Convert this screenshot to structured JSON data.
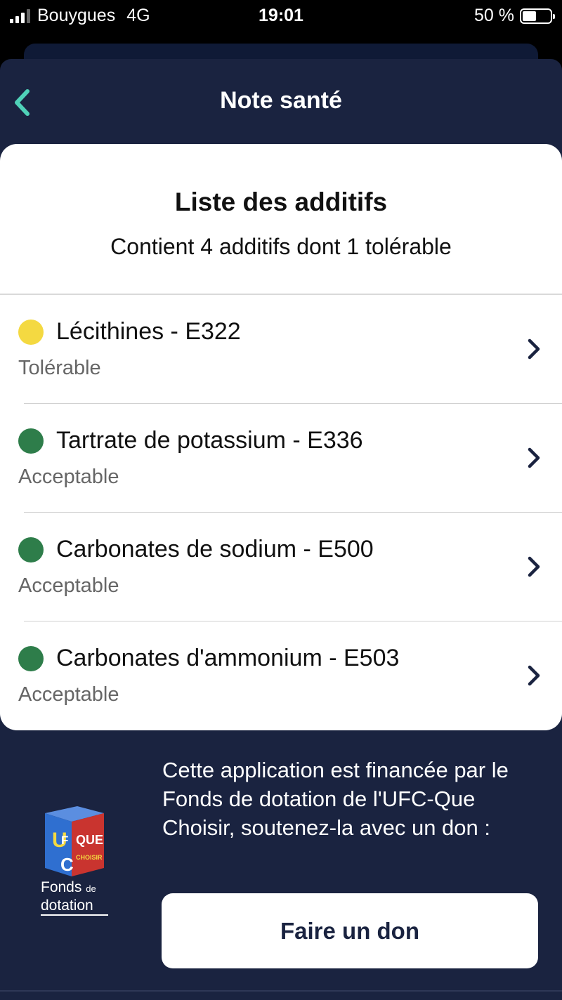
{
  "status_bar": {
    "carrier": "Bouygues",
    "network": "4G",
    "time": "19:01",
    "battery": "50 %"
  },
  "nav": {
    "title": "Note santé"
  },
  "card": {
    "title": "Liste des additifs",
    "subtitle": "Contient 4 additifs dont 1 tolérable",
    "items": [
      {
        "name": "Lécithines - E322",
        "status": "Tolérable",
        "color": "#f4d941"
      },
      {
        "name": "Tartrate de potassium - E336",
        "status": "Acceptable",
        "color": "#2e7d4a"
      },
      {
        "name": "Carbonates de sodium - E500",
        "status": "Acceptable",
        "color": "#2e7d4a"
      },
      {
        "name": "Carbonates d'ammonium - E503",
        "status": "Acceptable",
        "color": "#2e7d4a"
      }
    ]
  },
  "footer": {
    "text": "Cette application est financée par le Fonds de dotation de l'UFC-Que Choisir, soutenez-la avec un don :",
    "logo": {
      "letters_u": "U",
      "letters_f": "F",
      "letters_c": "C",
      "que": "QUE",
      "choisir": "CHOISIR",
      "line1": "Fonds",
      "de": "de",
      "line2": "dotation"
    },
    "donate_label": "Faire un don"
  },
  "colors": {
    "background": "#1a2340",
    "accent": "#4fd1b8",
    "tolerable": "#f4d941",
    "acceptable": "#2e7d4a"
  }
}
